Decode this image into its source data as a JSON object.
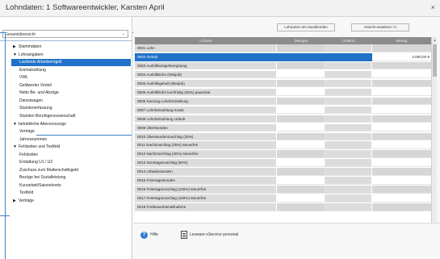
{
  "window": {
    "title": "Lohndaten: 1  Softwareentwickler, Karsten  April",
    "close_glyph": "×"
  },
  "sidebar": {
    "view_select": "Gesamtübersicht",
    "dropdown_glyph": "⌄",
    "items": [
      {
        "label": "Stammdaten",
        "level": 0,
        "state": "collapsed"
      },
      {
        "label": "Lohnangaben",
        "level": 0,
        "state": "expanded"
      },
      {
        "label": "Laufende Arbeitsentgelt",
        "level": 1,
        "state": "selected"
      },
      {
        "label": "Einmalzahlung",
        "level": 1
      },
      {
        "label": "VWL",
        "level": 1
      },
      {
        "label": "Geldwerter Vorteil",
        "level": 1
      },
      {
        "label": "Netto Be- und Abzüge",
        "level": 1
      },
      {
        "label": "Dienstwagen",
        "level": 1
      },
      {
        "label": "Stundenerfassung",
        "level": 1
      },
      {
        "label": "Stunden Berufsgenossenschaft",
        "level": 1
      },
      {
        "label": "betriebliche Altersvorsorge",
        "level": 0,
        "state": "expanded"
      },
      {
        "label": "Verträge",
        "level": 1
      },
      {
        "label": "Jahressummen",
        "level": 1
      },
      {
        "label": "Fehlzeiten und Textfeld",
        "level": 0,
        "state": "expanded"
      },
      {
        "label": "Fehlzeiten",
        "level": 1
      },
      {
        "label": "Erstattung U1 / U2",
        "level": 1
      },
      {
        "label": "Zuschuss zum Mutterschaftsgeld",
        "level": 1
      },
      {
        "label": "Bezüge bei Sozialleistung",
        "level": 1
      },
      {
        "label": "Kurzarbeit/Saisonkonto",
        "level": 1
      },
      {
        "label": "Textfeld",
        "level": 1
      },
      {
        "label": "Verträge",
        "level": 0,
        "state": "collapsed"
      }
    ]
  },
  "toolbar": {
    "toggle_button": "Lohnarten ein-/ausblenden",
    "extend_button": "Ansicht erweitern >>"
  },
  "grid": {
    "columns": [
      "Lohnart",
      "(Menge)",
      "(Faktor)",
      "Betrag"
    ],
    "rows": [
      {
        "lohnart": "0001 Lohn",
        "betrag": ""
      },
      {
        "lohnart": "0002 Gehalt",
        "betrag": "3.000,00 €",
        "selected": true
      },
      {
        "lohnart": "0003 Aushilfsentgeltvergütung",
        "betrag": ""
      },
      {
        "lohnart": "0004 Aushilfslohn (Minijob)",
        "betrag": ""
      },
      {
        "lohnart": "0005 Aushilfsgehalt (Minijob)",
        "betrag": ""
      },
      {
        "lohnart": "0006 Aushilfslohn kurzfristig (25%) pauschal",
        "betrag": ""
      },
      {
        "lohnart": "0006 Kürzung Lohnfortzahlung",
        "betrag": ""
      },
      {
        "lohnart": "0007 Lohnfortzahlung Krank",
        "betrag": ""
      },
      {
        "lohnart": "0008 Lohnfortzahlung Urlaub",
        "betrag": ""
      },
      {
        "lohnart": "0009 Überstunden",
        "betrag": ""
      },
      {
        "lohnart": "0010 Überstundenzuschlag (25%)",
        "betrag": ""
      },
      {
        "lohnart": "0011 Nachtzuschlag (25%) steuerfrei",
        "betrag": ""
      },
      {
        "lohnart": "0012 Nachtzuschlag (40%) steuerfrei",
        "betrag": ""
      },
      {
        "lohnart": "0013 Sonntagszuschlag (50%)",
        "betrag": ""
      },
      {
        "lohnart": "0014 Urlaubsstunden",
        "betrag": ""
      },
      {
        "lohnart": "0015 Feiertagsstunden",
        "betrag": ""
      },
      {
        "lohnart": "0016 Feiertagszuschlag (125%) steuerfrei",
        "betrag": ""
      },
      {
        "lohnart": "0017 Feiertagszuschlag (150%) steuerfrei",
        "betrag": ""
      },
      {
        "lohnart": "0018 Fortbewerbsmaßnahme",
        "betrag": ""
      }
    ]
  },
  "footer": {
    "help_label": "Hilfe",
    "help_glyph": "?",
    "ldoc_label": "Lexware eService personal"
  },
  "icons": {
    "collapsed_arrow": "▶",
    "expanded_arrow": "▼"
  },
  "colors": {
    "accent": "#1f72c7",
    "marker": "#3f7fc4",
    "header_gray": "#8c8c8c"
  }
}
